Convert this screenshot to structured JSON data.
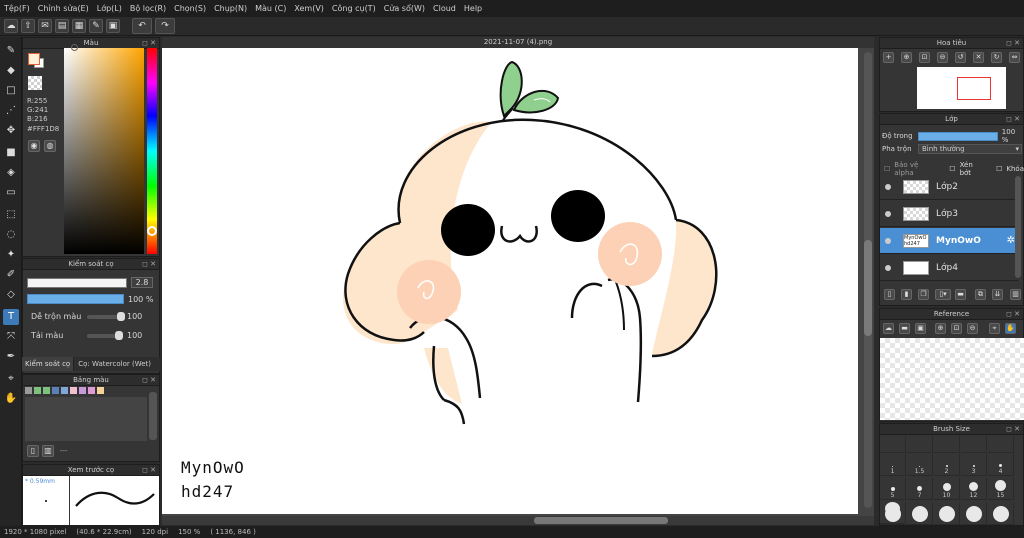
{
  "menu": [
    "Tệp(F)",
    "Chỉnh sửa(E)",
    "Lớp(L)",
    "Bộ lọc(R)",
    "Chọn(S)",
    "Chụp(N)",
    "Màu (C)",
    "Xem(V)",
    "Công cụ(T)",
    "Cửa sổ(W)",
    "Cloud",
    "Help"
  ],
  "document": {
    "tab_title": "2021-11-07 (4).png"
  },
  "color_panel": {
    "title": "Màu",
    "rgb": [
      "R:255",
      "G:241",
      "B:216"
    ],
    "hex": "#FFF1D8",
    "fg_color": "#fff1d8"
  },
  "brush_control": {
    "title": "Kiểm soát cọ",
    "size_value": "2.8",
    "opacity_value": "100 %",
    "blend_label": "Dễ trộn màu",
    "blend_value": "100",
    "reload_label": "Tải màu",
    "reload_value": "100",
    "tab_label": "Kiểm soát cọ",
    "brush_info": "Cọ: Watercolor (Wet)"
  },
  "palette": {
    "title": "Bảng màu",
    "colors": [
      "#9a9a9a",
      "#7ec07e",
      "#7ec07e",
      "#5d7fb8",
      "#7fa7d8",
      "#f0c0d0",
      "#c79ad8",
      "#e09ad8",
      "#f4d29a"
    ],
    "more_label": "---"
  },
  "brush_preview": {
    "title": "Xem trước cọ",
    "size_label": "* 0.59mm"
  },
  "navigator": {
    "title": "Hoa tiêu"
  },
  "layers": {
    "title": "Lớp",
    "opacity_label": "Độ trong",
    "opacity_value": "100 %",
    "blend_label": "Pha trộn",
    "blend_value": "Bình thường",
    "protect_alpha": "Bảo vệ alpha",
    "clipping": "Xén bớt",
    "lock": "Khóa",
    "items": [
      {
        "name": "Lớp2",
        "selected": false
      },
      {
        "name": "Lớp3",
        "selected": false
      },
      {
        "name": "MynOwO",
        "selected": true,
        "thumb_text": "MynOwO hd247"
      },
      {
        "name": "Lớp4",
        "selected": false
      }
    ]
  },
  "reference": {
    "title": "Reference"
  },
  "brush_size": {
    "title": "Brush Size",
    "sizes": [
      "1",
      "1.5",
      "2",
      "3",
      "4",
      "5",
      "7",
      "10",
      "12",
      "15",
      "20"
    ]
  },
  "canvas_text": {
    "line1": "MynOwO",
    "line2": "hd247"
  },
  "status": {
    "pixels": "1920 * 1080 pixel",
    "cm": "(40.6 * 22.9cm)",
    "dpi": "120 dpi",
    "zoom": "150 %",
    "coords": "( 1136, 846 )"
  }
}
